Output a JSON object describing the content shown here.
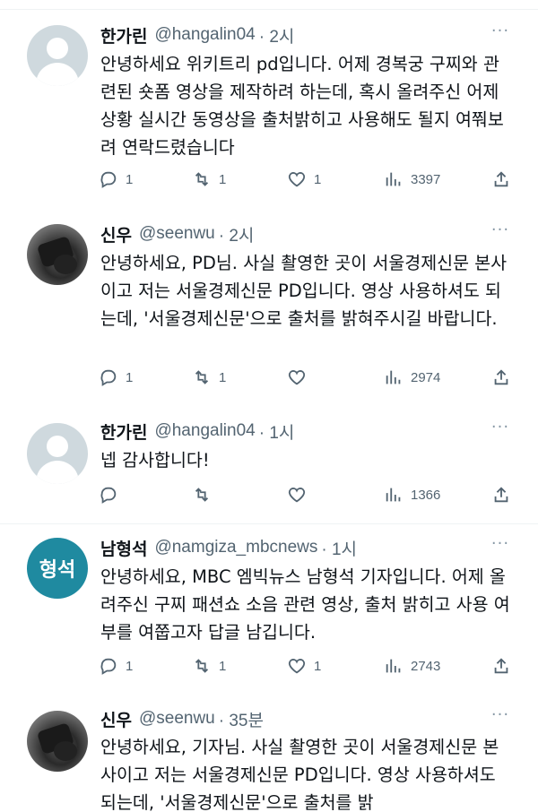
{
  "tweets": [
    {
      "name": "한가린",
      "handle": "@hangalin04",
      "time": "· 2시",
      "text": "안녕하세요 위키트리 pd입니다. 어제 경복궁 구찌와 관련된 숏폼 영상을 제작하려 하는데, 혹시 올려주신 어제 상황 실시간 동영상을 출처밝히고 사용해도 될지 여쭤보려 연락드렸습니다",
      "avatar": "default-avatar",
      "reply_count": "1",
      "retweet_count": "1",
      "like_count": "1",
      "views": "3397"
    },
    {
      "name": "신우",
      "handle": "@seenwu",
      "time": "· 2시",
      "text": "안녕하세요, PD님. 사실 촬영한 곳이 서울경제신문 본사이고 저는 서울경제신문 PD입니다. 영상 사용하셔도 되는데, '서울경제신문'으로 출처를 밝혀주시길 바랍니다.",
      "avatar": "camera-photo-avatar",
      "reply_count": "1",
      "retweet_count": "1",
      "like_count": "",
      "views": "2974"
    },
    {
      "name": "한가린",
      "handle": "@hangalin04",
      "time": "· 1시",
      "text": "넵 감사합니다!",
      "avatar": "default-avatar",
      "reply_count": "",
      "retweet_count": "",
      "like_count": "",
      "views": "1366"
    },
    {
      "name": "남형석",
      "handle": "@namgiza_mbcnews",
      "time": "· 1시",
      "text": "안녕하세요, MBC 엠빅뉴스 남형석 기자입니다. 어제 올려주신 구찌 패션쇼 소음 관련 영상, 출처 밝히고 사용 여부를 여쭙고자 답글 남깁니다.",
      "avatar": "text-avatar",
      "avatar_text": "형석",
      "avatar_color": "#1f8aa0",
      "reply_count": "1",
      "retweet_count": "1",
      "like_count": "1",
      "views": "2743"
    },
    {
      "name": "신우",
      "handle": "@seenwu",
      "time": "· 35분",
      "text": "안녕하세요, 기자님. 사실 촬영한 곳이 서울경제신문 본사이고 저는 서울경제신문 PD입니다. 영상 사용하셔도 되는데, '서울경제신문'으로 출처를 밝",
      "avatar": "camera-photo-avatar"
    }
  ],
  "colors": {
    "text": "#0f1419",
    "secondary": "#536471",
    "divider": "#eff3f4"
  }
}
